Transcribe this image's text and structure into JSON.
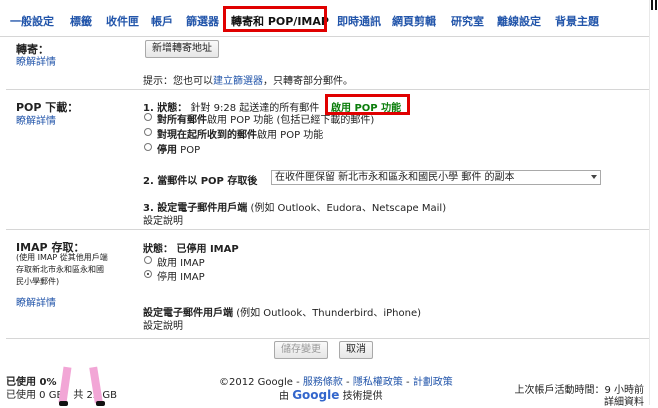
{
  "tabs": [
    {
      "label": "一般設定"
    },
    {
      "label": "標籤"
    },
    {
      "label": "收件匣"
    },
    {
      "label": "帳戶"
    },
    {
      "label": "篩選器"
    },
    {
      "label": "轉寄和 POP/IMAP"
    },
    {
      "label": "即時通訊"
    },
    {
      "label": "網頁剪輯"
    },
    {
      "label": "研究室"
    },
    {
      "label": "離線設定"
    },
    {
      "label": "背景主題"
    }
  ],
  "forwarding": {
    "title": "轉寄：",
    "learn_more": "瞭解詳情",
    "add_button": "新增轉寄地址",
    "tip_prefix": "提示：您也可以",
    "tip_link": "建立篩選器",
    "tip_suffix": "，只轉寄部分郵件。"
  },
  "pop": {
    "title": "POP 下載：",
    "learn_more": "瞭解詳情",
    "status_label": "1. 狀態：",
    "status_text": "針對 9:28 起送達的所有郵件",
    "status_value": "啟用 POP 功能",
    "options": [
      {
        "label_bold": "對所有郵件",
        "label_rest": "啟用 POP 功能 (包括已經下載的郵件)",
        "checked": false
      },
      {
        "label_bold": "對現在起所收到的郵件",
        "label_rest": "啟用 POP 功能",
        "checked": false
      },
      {
        "label_bold": "停用",
        "label_rest": " POP",
        "checked": false
      }
    ],
    "when_label": "2. 當郵件以 POP 存取後",
    "when_select": "在收件匣保留 新北市永和區永和國民小學 郵件 的副本",
    "configure_label": "3. 設定電子郵件用戶端",
    "configure_hint": "(例如 Outlook、Eudora、Netscape Mail)",
    "config_link": "設定說明"
  },
  "imap": {
    "title": "IMAP 存取：",
    "note": "(使用 IMAP 從其他用戶端存取新北市永和區永和國民小學郵件)",
    "learn_more": "瞭解詳情",
    "status_label": "狀態：",
    "status_value": "已停用 IMAP",
    "options": [
      {
        "label": "啟用 IMAP",
        "checked": false
      },
      {
        "label": "停用 IMAP",
        "checked": true
      }
    ],
    "configure_label": "設定電子郵件用戶端",
    "configure_hint": "(例如 Outlook、Thunderbird、iPhone)",
    "config_link": "設定說明"
  },
  "actions": {
    "save": "儲存變更",
    "cancel": "取消"
  },
  "footer": {
    "usage_label": "已使用 0%",
    "usage_detail": "已使用 0 GB，共 25 GB",
    "copyright": "©2012 Google",
    "terms": "服務條款",
    "privacy": "隱私權政策",
    "program": "計劃政策",
    "powered_prefix": "由",
    "powered_brand": "Google",
    "powered_suffix": "技術提供",
    "last_activity": "上次帳戶活動時間：9 小時前",
    "details": "詳細資料"
  }
}
